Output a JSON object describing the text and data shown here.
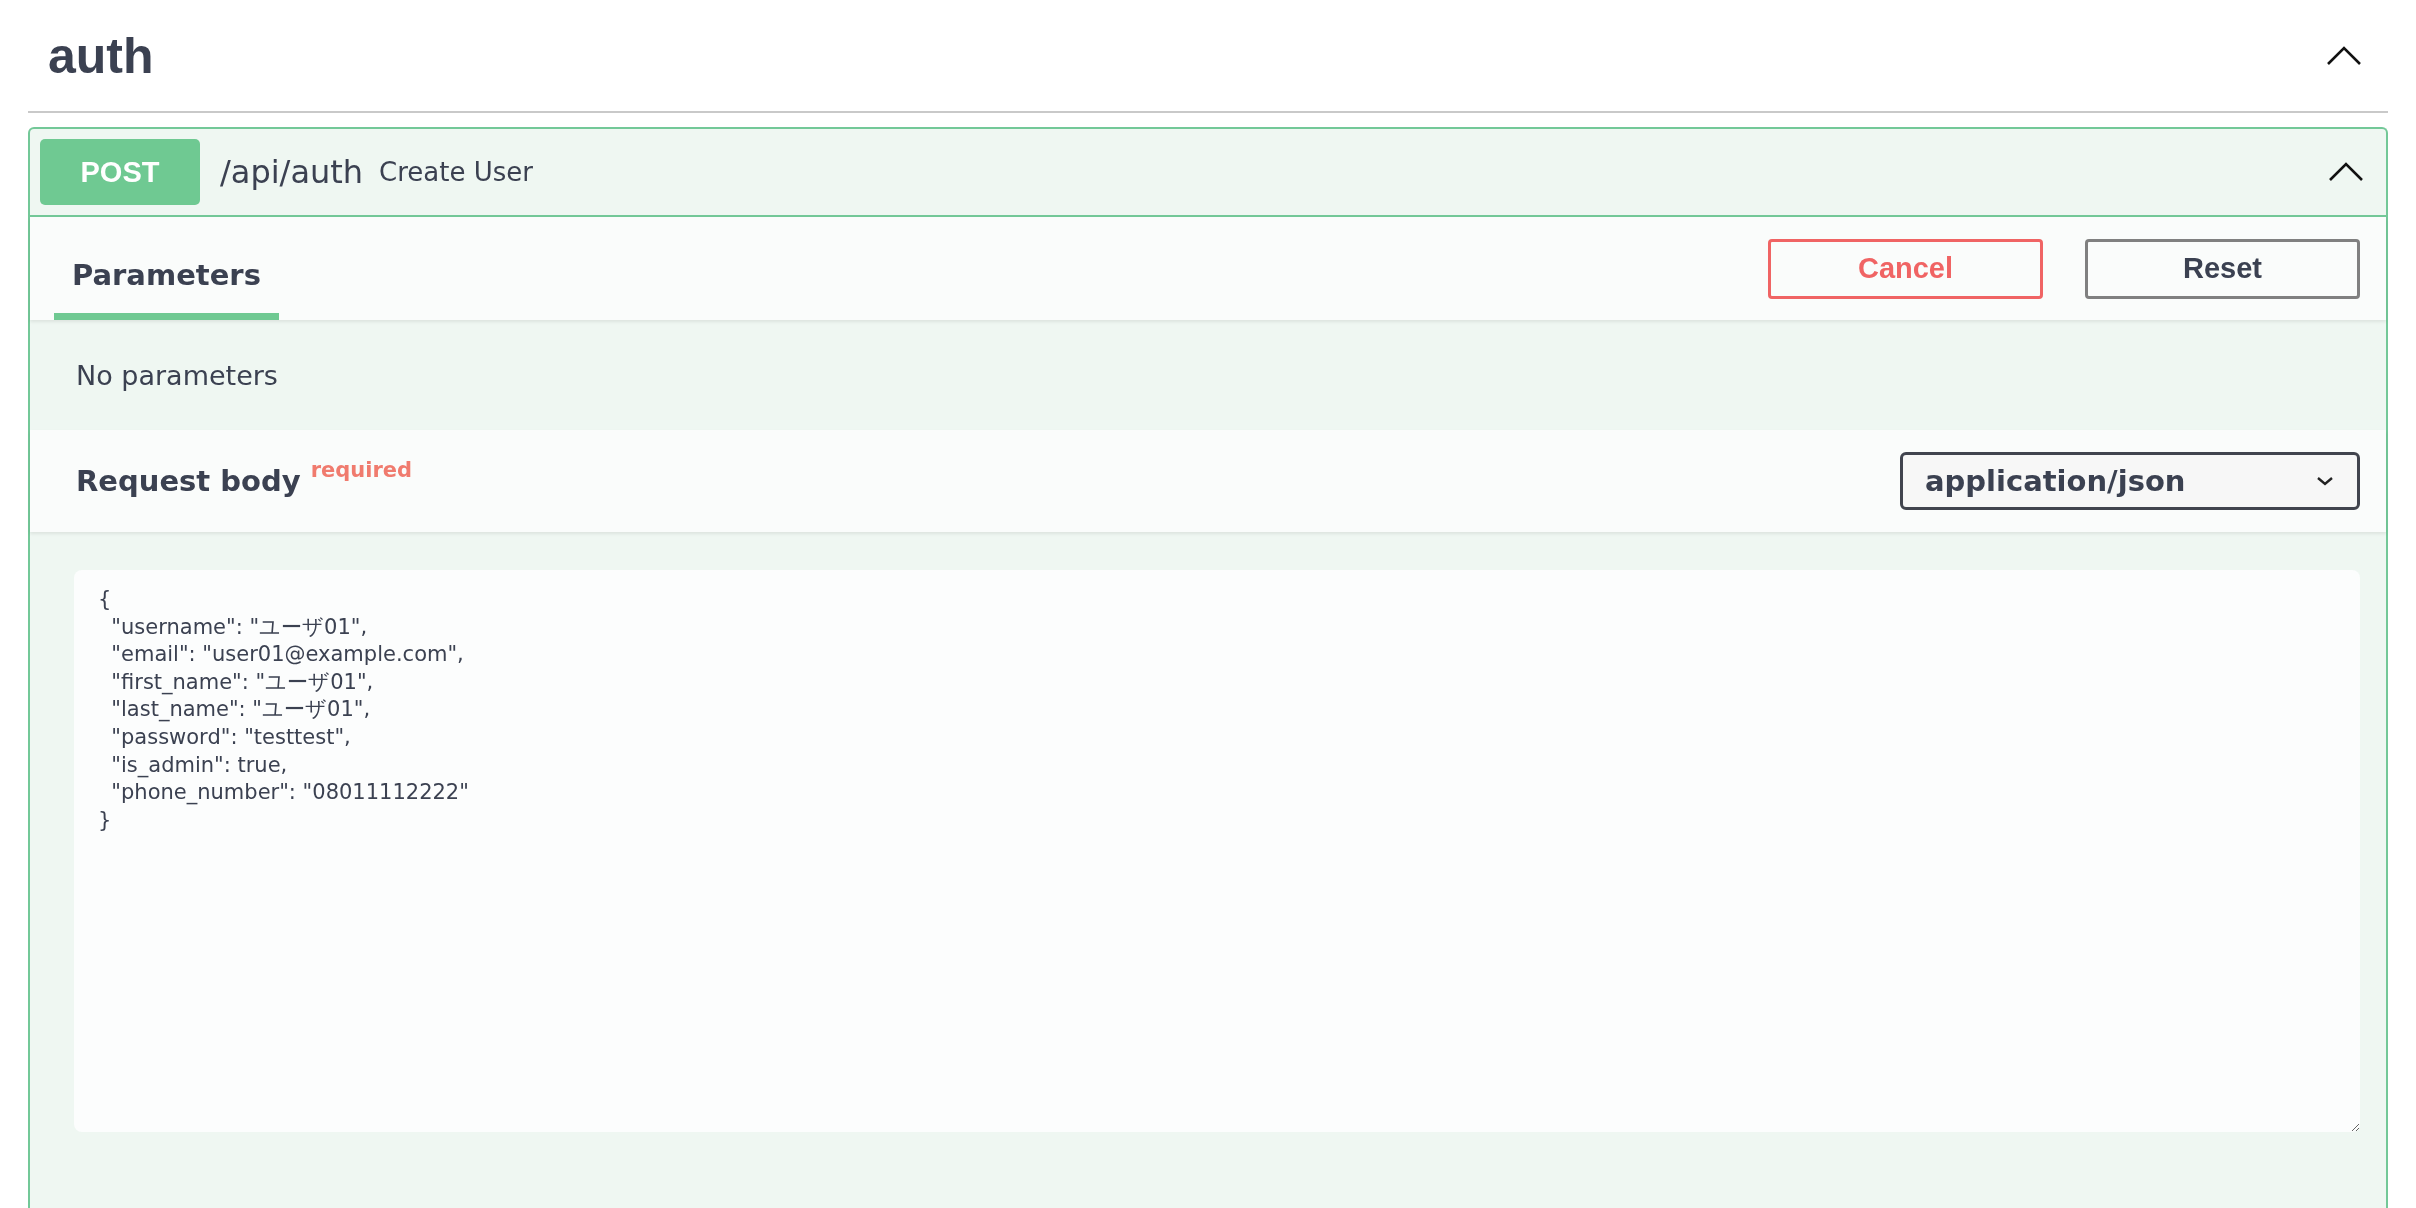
{
  "section": {
    "title": "auth",
    "expanded": true
  },
  "operation": {
    "method": "POST",
    "path": "/api/auth",
    "summary": "Create User",
    "expanded": true
  },
  "tabs": [
    {
      "label": "Parameters",
      "selected": true
    }
  ],
  "buttons": [
    {
      "label": "Cancel",
      "kind": "cancel"
    },
    {
      "label": "Reset",
      "kind": "reset"
    }
  ],
  "parameters_message": "No parameters",
  "request_body": {
    "title": "Request body",
    "required_label": "required",
    "content_type": "application/json",
    "value": "{\n  \"username\": \"ユーザ01\",\n  \"email\": \"user01@example.com\",\n  \"first_name\": \"ユーザ01\",\n  \"last_name\": \"ユーザ01\",\n  \"password\": \"testtest\",\n  \"is_admin\": true,\n  \"phone_number\": \"08011112222\"\n}"
  }
}
